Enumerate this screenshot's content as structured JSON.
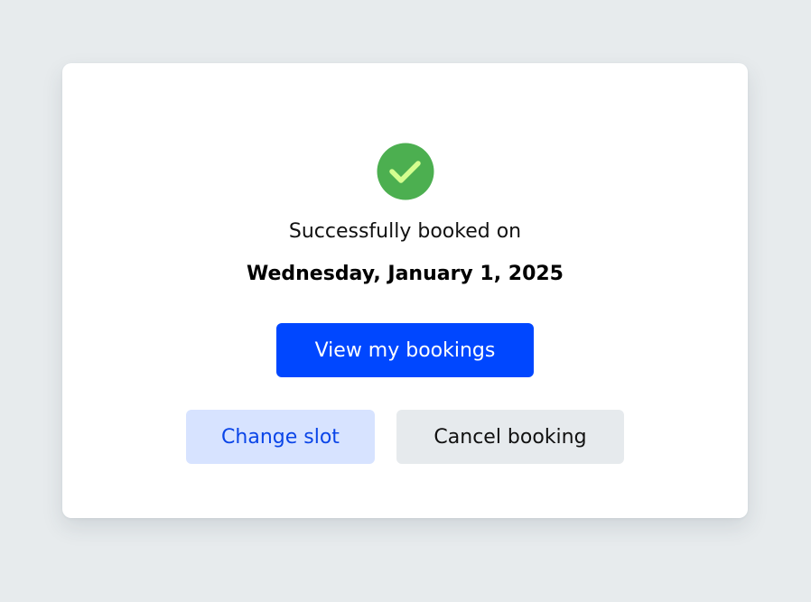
{
  "confirmation": {
    "icon": "check-circle-icon",
    "message": "Successfully booked on",
    "date": "Wednesday, January 1, 2025"
  },
  "actions": {
    "view_bookings_label": "View my bookings",
    "change_slot_label": "Change slot",
    "cancel_booking_label": "Cancel booking"
  },
  "colors": {
    "page_background": "#e7ebed",
    "card_background": "#ffffff",
    "success_green": "#4caf50",
    "check_mark": "#d4ff8f",
    "primary_blue": "#0047ff",
    "secondary_blue_bg": "#d7e3ff",
    "neutral_bg": "#e6eaed"
  }
}
